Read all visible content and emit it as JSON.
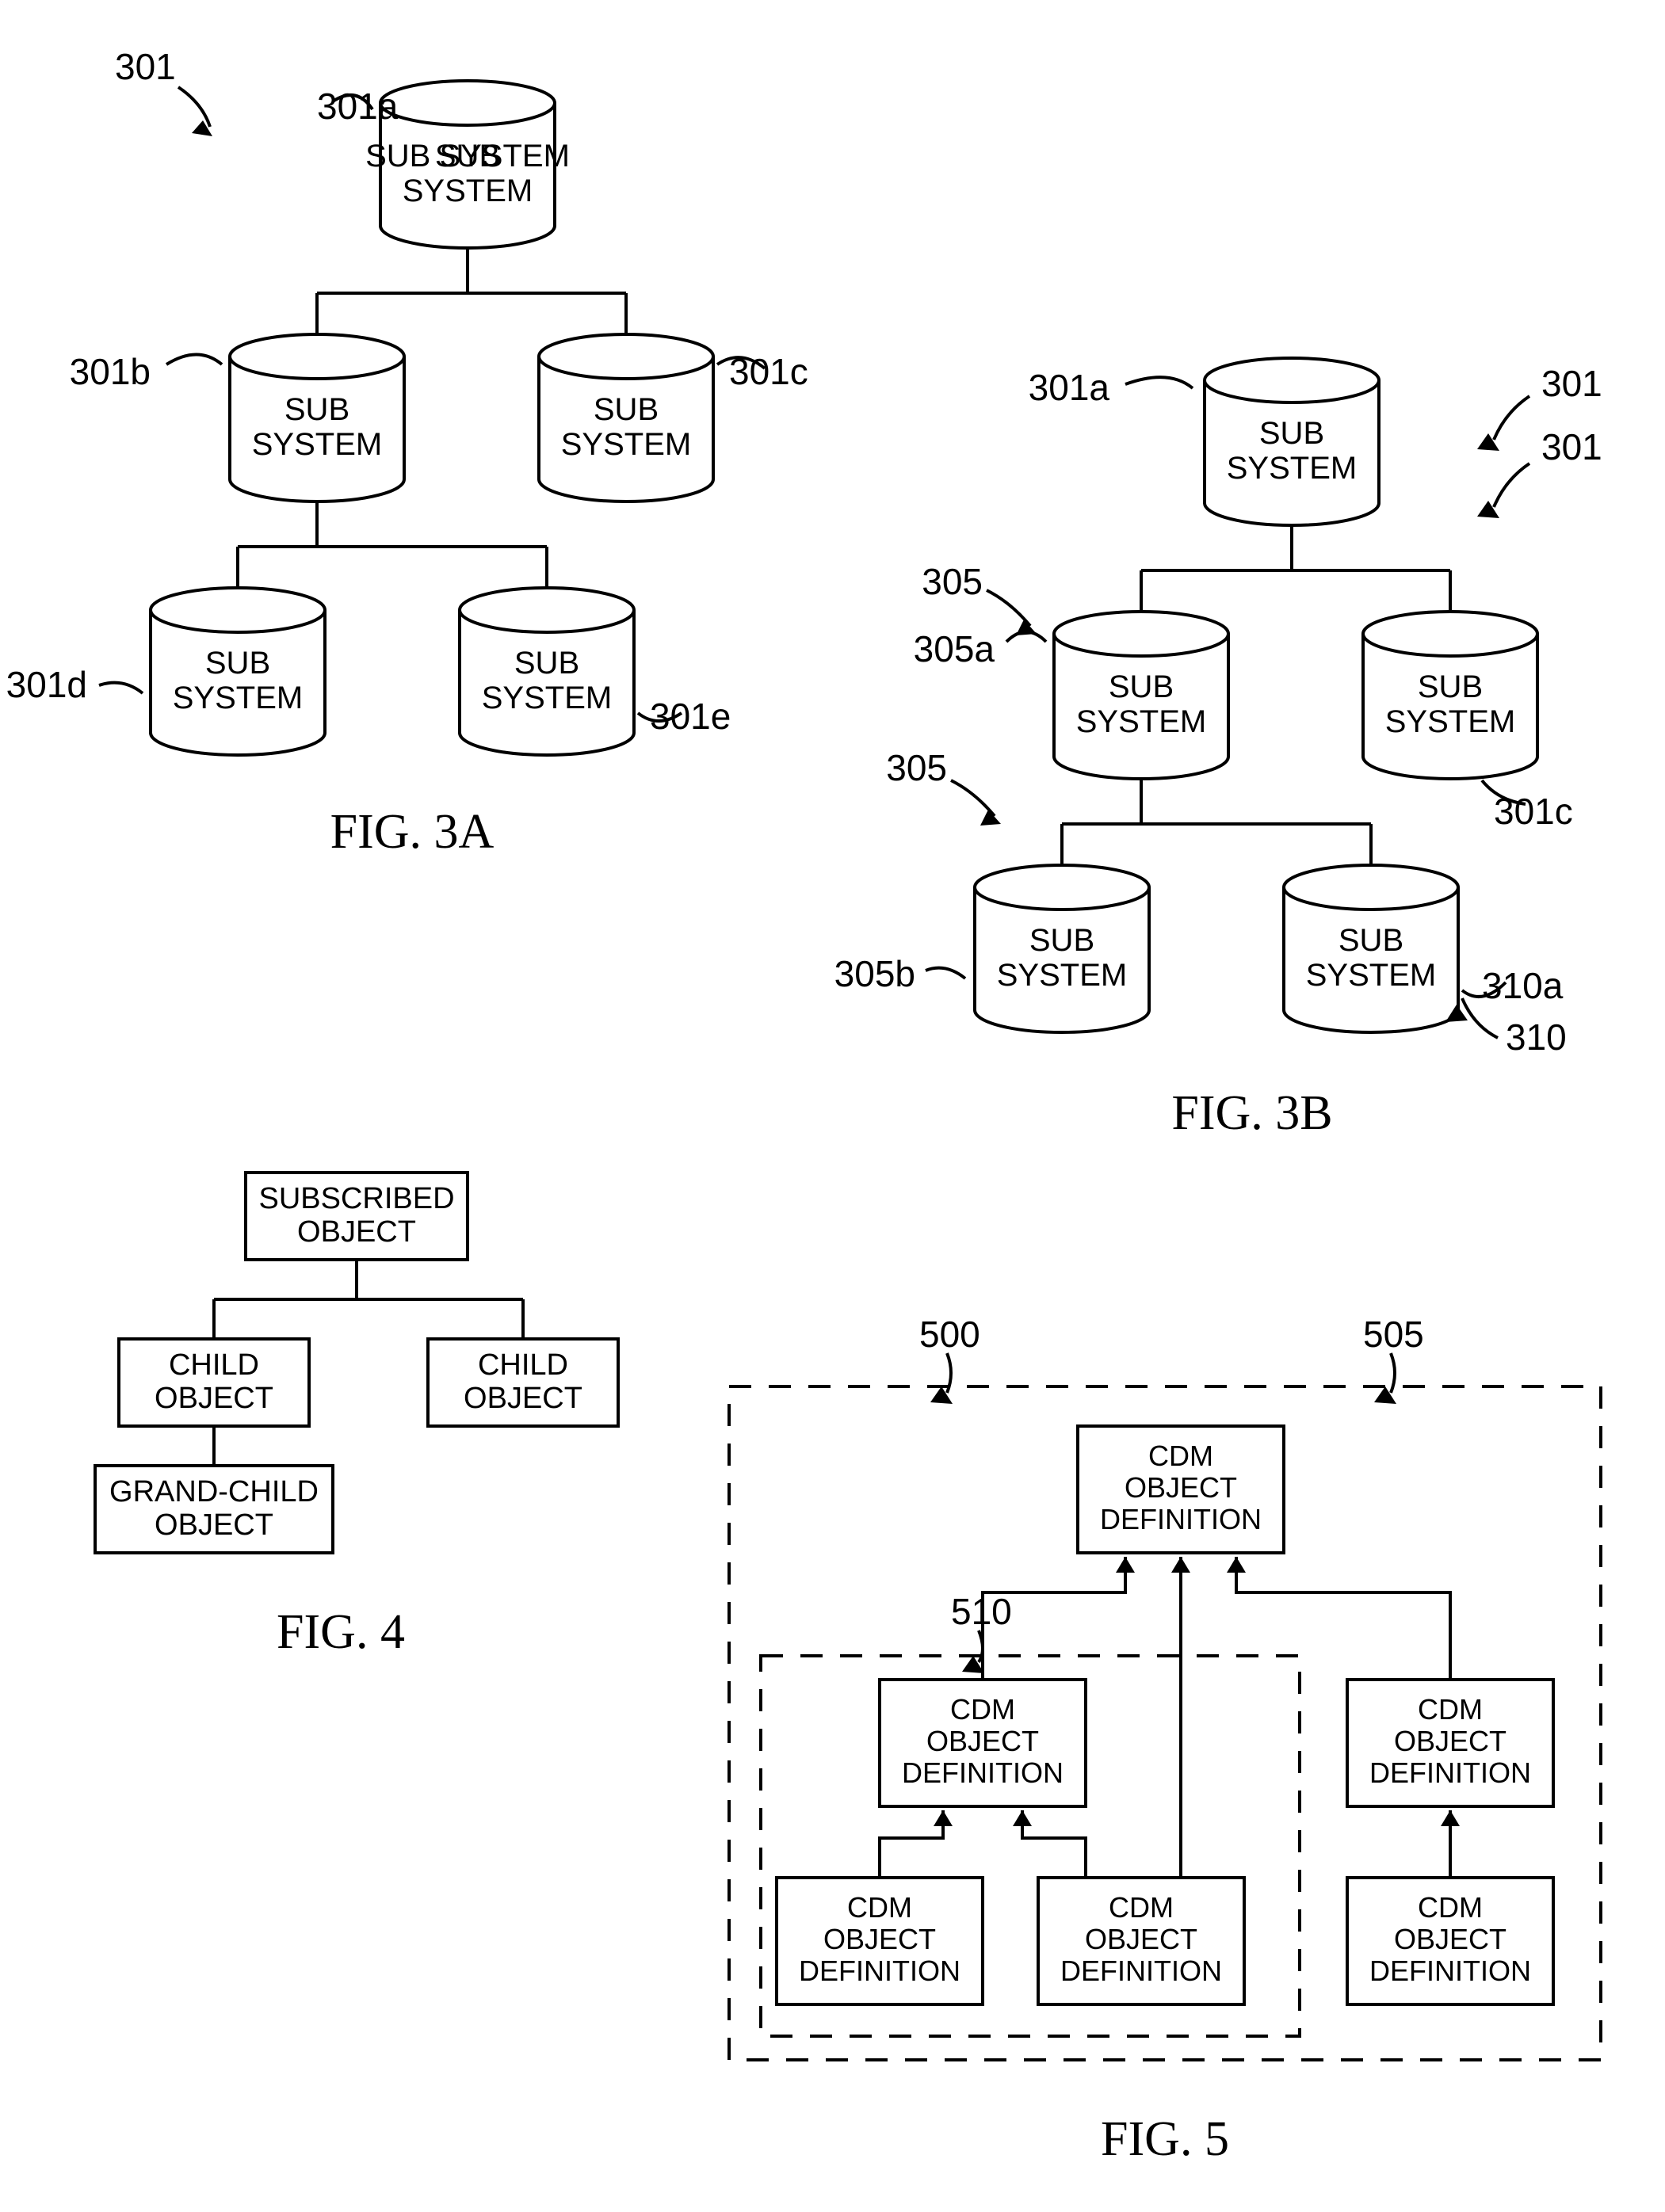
{
  "fig3a": {
    "caption": "FIG. 3A",
    "ref_top": "301",
    "nodes": {
      "a": {
        "text": "SUB SYSTEM",
        "ref": "301a"
      },
      "b": {
        "text": "SUB SYSTEM",
        "ref": "301b"
      },
      "c": {
        "text": "SUB SYSTEM",
        "ref": "301c"
      },
      "d": {
        "text": "SUB SYSTEM",
        "ref": "301d"
      },
      "e": {
        "text": "SUB SYSTEM",
        "ref": "301e"
      }
    }
  },
  "fig3b": {
    "caption": "FIG. 3B",
    "nodes": {
      "top": {
        "text": "SUB SYSTEM",
        "ref": "301a"
      },
      "midL": {
        "text": "SUB SYSTEM",
        "refL": "305a",
        "refT": "305"
      },
      "midR": {
        "text": "SUB SYSTEM",
        "ref": "301c"
      },
      "botL": {
        "text": "SUB SYSTEM",
        "ref": "305b",
        "refT": "305"
      },
      "botR": {
        "text": "SUB SYSTEM",
        "ref1": "310a",
        "ref2": "310"
      }
    },
    "refs_topright": {
      "a": "301",
      "b": "301"
    }
  },
  "fig4": {
    "caption": "FIG. 4",
    "root": "SUBSCRIBED OBJECT",
    "childL": "CHILD OBJECT",
    "childR": "CHILD OBJECT",
    "grand": "GRAND-CHILD OBJECT"
  },
  "fig5": {
    "caption": "FIG. 5",
    "ref_outer_top": "500",
    "ref_outer": "505",
    "ref_inner": "510",
    "top": "CDM OBJECT DEFINITION",
    "midL": "CDM OBJECT DEFINITION",
    "midR": "CDM OBJECT DEFINITION",
    "botL": "CDM OBJECT DEFINITION",
    "botM": "CDM OBJECT DEFINITION",
    "botR": "CDM OBJECT DEFINITION"
  }
}
